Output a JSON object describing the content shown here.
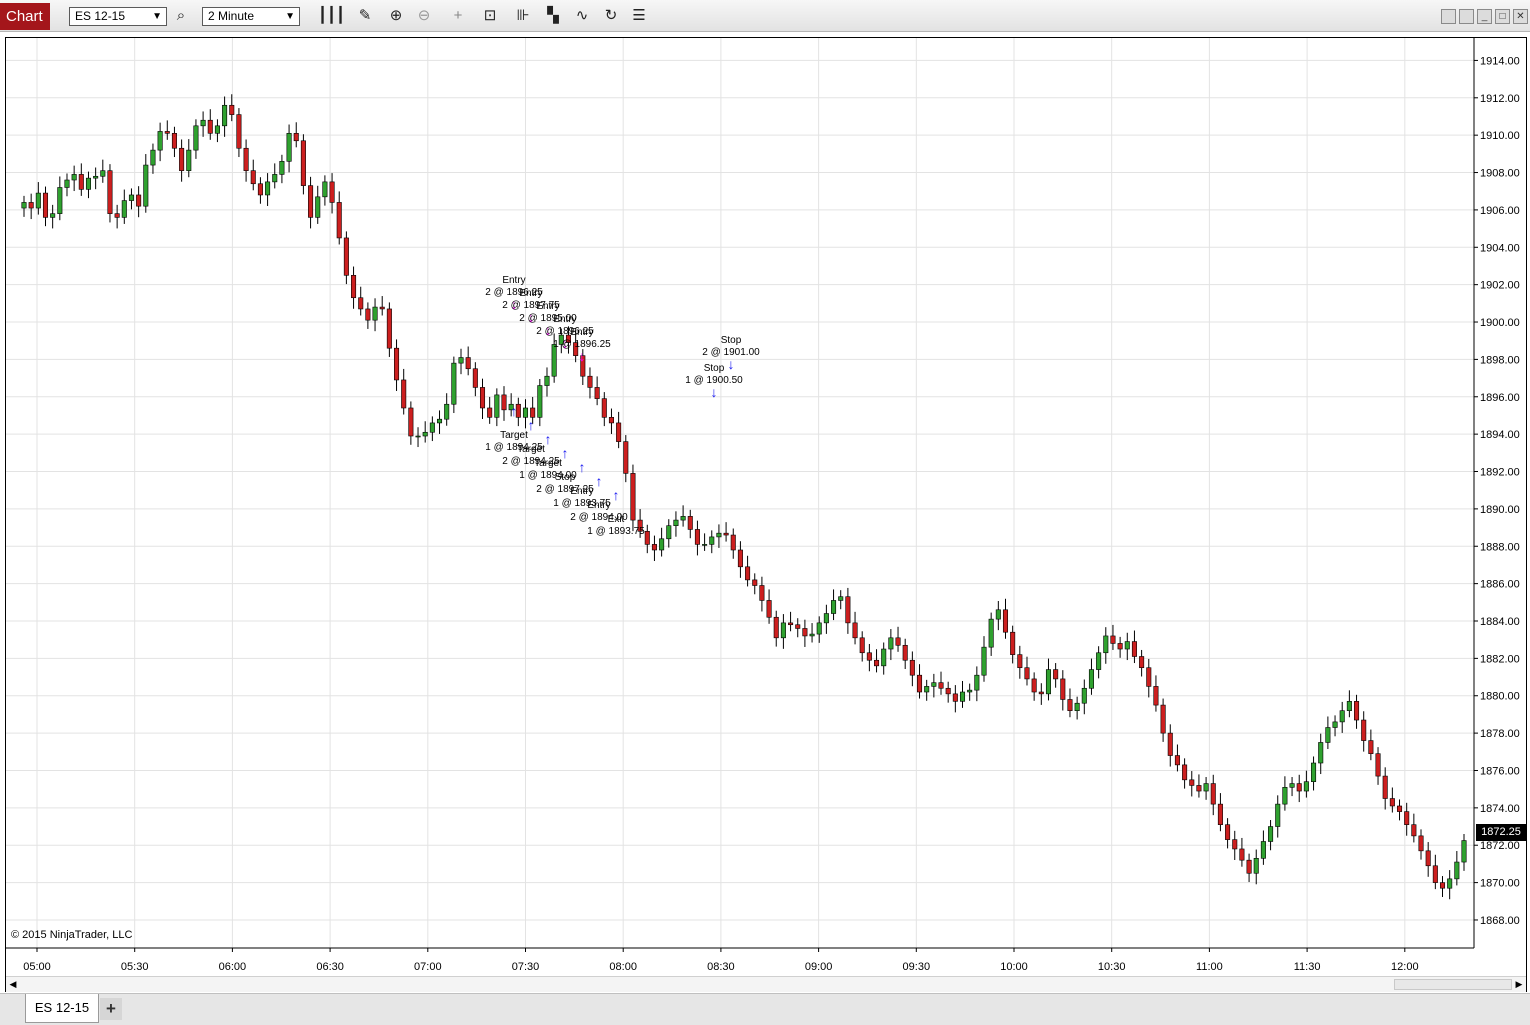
{
  "window": {
    "title": "Chart",
    "instrument": "ES 12-15",
    "interval": "2 Minute",
    "copyright": "© 2015 NinjaTrader, LLC",
    "tab_label": "ES 12-15",
    "add_tab_label": "+"
  },
  "toolbar_icons": [
    "search-icon",
    "bar-type-icon",
    "drawing-tool-icon",
    "zoom-in-icon",
    "zoom-out-icon",
    "crosshair-icon",
    "data-box-icon",
    "properties-icon",
    "strategies-icon",
    "indicators-icon",
    "reload-icon",
    "list-icon"
  ],
  "colors": {
    "up_candle": "#2fa12f",
    "down_candle": "#cc1f1f",
    "grid": "#e3e3e3",
    "buy_marker": "#1a1af0",
    "sell_marker": "#ff00ff",
    "title_tab": "#a4161b"
  },
  "chart_data": {
    "type": "candlestick",
    "y_tick_labels": [
      "1914.00",
      "1912.00",
      "1910.00",
      "1908.00",
      "1906.00",
      "1904.00",
      "1902.00",
      "1900.00",
      "1898.00",
      "1896.00",
      "1894.00",
      "1892.00",
      "1890.00",
      "1888.00",
      "1886.00",
      "1884.00",
      "1882.00",
      "1880.00",
      "1878.00",
      "1876.00",
      "1874.00",
      "1872.00",
      "1870.00",
      "1868.00"
    ],
    "x_tick_labels": [
      "05:00",
      "05:30",
      "06:00",
      "06:30",
      "07:00",
      "07:30",
      "08:00",
      "08:30",
      "09:00",
      "09:30",
      "10:00",
      "10:30",
      "11:00",
      "11:30",
      "12:00"
    ],
    "ylim": [
      1866.5,
      1915.2
    ],
    "last_price": "1872.25",
    "closes": [
      1906.4,
      1906.1,
      1906.9,
      1905.6,
      1905.8,
      1907.2,
      1907.6,
      1907.9,
      1907.1,
      1907.7,
      1907.8,
      1908.1,
      1905.8,
      1905.6,
      1906.5,
      1906.8,
      1906.2,
      1908.4,
      1909.2,
      1910.2,
      1910.1,
      1909.3,
      1908.1,
      1909.2,
      1910.5,
      1910.8,
      1910.1,
      1910.5,
      1911.6,
      1911.1,
      1909.3,
      1908.1,
      1907.4,
      1906.8,
      1907.5,
      1907.9,
      1908.6,
      1910.1,
      1909.7,
      1907.3,
      1905.6,
      1906.7,
      1907.5,
      1906.4,
      1904.5,
      1902.5,
      1901.3,
      1900.7,
      1900.1,
      1900.8,
      1900.7,
      1898.6,
      1896.9,
      1895.4,
      1893.9,
      1893.9,
      1894.1,
      1894.6,
      1894.8,
      1895.6,
      1897.8,
      1898.1,
      1897.5,
      1896.5,
      1895.4,
      1894.9,
      1896.1,
      1895.3,
      1895.6,
      1894.9,
      1895.4,
      1894.9,
      1896.6,
      1897.1,
      1898.8,
      1899.3,
      1898.9,
      1898.2,
      1897.1,
      1896.5,
      1895.9,
      1894.9,
      1894.6,
      1893.6,
      1891.9,
      1889.4,
      1888.8,
      1888.1,
      1887.8,
      1888.4,
      1889.1,
      1889.4,
      1889.6,
      1888.9,
      1888.1,
      1888.1,
      1888.5,
      1888.7,
      1888.6,
      1887.8,
      1886.9,
      1886.2,
      1885.9,
      1885.1,
      1884.2,
      1883.1,
      1883.9,
      1883.8,
      1883.6,
      1883.2,
      1883.3,
      1883.9,
      1884.4,
      1885.1,
      1885.3,
      1883.9,
      1883.1,
      1882.3,
      1881.9,
      1881.6,
      1882.5,
      1883.1,
      1882.7,
      1881.9,
      1881.1,
      1880.2,
      1880.5,
      1880.7,
      1880.4,
      1880.1,
      1879.7,
      1880.2,
      1880.3,
      1881.1,
      1882.6,
      1884.1,
      1884.6,
      1883.4,
      1882.2,
      1881.5,
      1880.9,
      1880.2,
      1880.1,
      1881.4,
      1880.9,
      1879.8,
      1879.2,
      1879.6,
      1880.4,
      1881.4,
      1882.3,
      1883.2,
      1882.8,
      1882.5,
      1882.9,
      1882.1,
      1881.5,
      1880.5,
      1879.5,
      1878.0,
      1876.8,
      1876.3,
      1875.5,
      1875.2,
      1874.9,
      1875.3,
      1874.2,
      1873.1,
      1872.3,
      1871.8,
      1871.2,
      1870.5,
      1871.3,
      1872.2,
      1873.0,
      1874.2,
      1875.1,
      1875.3,
      1874.9,
      1875.4,
      1876.4,
      1877.5,
      1878.3,
      1878.6,
      1879.2,
      1879.7,
      1878.7,
      1877.6,
      1876.9,
      1875.7,
      1874.5,
      1874.1,
      1873.8,
      1873.1,
      1872.5,
      1871.7,
      1870.9,
      1870.0,
      1869.7,
      1870.2,
      1871.1,
      1872.25
    ],
    "trade_annotations": [
      {
        "label": "Entry",
        "detail": "2 @ 1896.25",
        "kind": "sell"
      },
      {
        "label": "Entry",
        "detail": "2 @ 1897.75",
        "kind": "sell"
      },
      {
        "label": "Entry",
        "detail": "2 @ 1895.00",
        "kind": "sell"
      },
      {
        "label": "Entry",
        "detail": "2 @ 1896.25",
        "kind": "sell"
      },
      {
        "label": "Entry",
        "detail": "1 @ 1896.25",
        "kind": "sell"
      },
      {
        "label": "Stop",
        "detail": "1 @ 1900.50",
        "kind": "exit"
      },
      {
        "label": "Stop",
        "detail": "2 @ 1901.00",
        "kind": "exit"
      },
      {
        "label": "Target",
        "detail": "1 @ 1894.25",
        "kind": "buy"
      },
      {
        "label": "Target",
        "detail": "2 @ 1894.25",
        "kind": "buy"
      },
      {
        "label": "Target",
        "detail": "1 @ 1894.00",
        "kind": "buy"
      },
      {
        "label": "Stop",
        "detail": "2 @ 1897.25",
        "kind": "buy"
      },
      {
        "label": "Entry",
        "detail": "1 @ 1893.75",
        "kind": "buy"
      },
      {
        "label": "Entry",
        "detail": "2 @ 1894.00",
        "kind": "buy"
      },
      {
        "label": "Exit",
        "detail": "1 @ 1893.75",
        "kind": "buy"
      }
    ]
  }
}
